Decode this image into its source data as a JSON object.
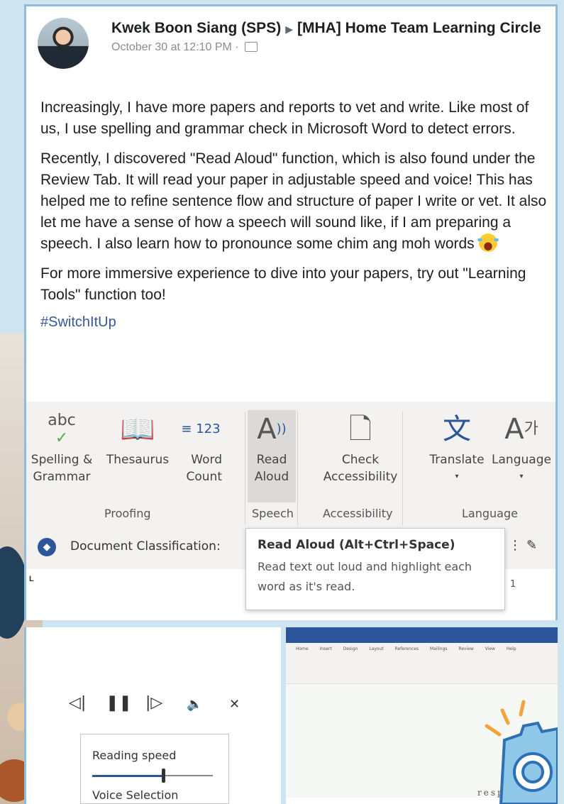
{
  "post": {
    "author": "Kwek Boon Siang (SPS)",
    "group": "[MHA] Home Team Learning Circle",
    "timestamp": "October 30 at 12:10 PM",
    "paragraphs": [
      "Increasingly, I have more papers and reports to vet and write. Like most of us, I use spelling and grammar check in Microsoft Word to detect errors.",
      "Recently, I discovered \"Read Aloud\" function, which is also found under the Review Tab. It will read your paper in adjustable speed and voice! This has helped me to refine sentence flow and structure of paper I write or vet. It also let me have a sense of how a speech will sound like, if I am preparing a speech. I also learn how to pronounce some chim ang moh words",
      "For more immersive experience to dive into your papers, try out \"Learning Tools\" function too!"
    ],
    "hashtag": "#SwitchItUp"
  },
  "ribbon": {
    "spelling_label": "Spelling & Grammar",
    "thesaurus_label": "Thesaurus",
    "word_count_label": "Word Count",
    "read_aloud_label": "Read Aloud",
    "check_accessibility_label": "Check Accessibility",
    "translate_label": "Translate",
    "language_label": "Language",
    "groups": {
      "proofing": "Proofing",
      "speech": "Speech",
      "accessibility": "Accessibility",
      "language": "Language"
    },
    "icons": {
      "abc": "abc",
      "word_count": "123"
    }
  },
  "classification": {
    "label": "Document Classification:"
  },
  "tooltip": {
    "title": "Read Aloud (Alt+Ctrl+Space)",
    "description": "Read text out loud and highlight each word as it's read."
  },
  "ruler": {
    "marker": "1"
  },
  "player": {
    "reading_speed_label": "Reading speed",
    "reading_speed_value": 0.59,
    "voice_selection_label": "Voice Selection"
  },
  "word_screenshot": {
    "tabs": "Home Insert Design Layout References Mailings Review View Help",
    "watermark": "respon"
  }
}
